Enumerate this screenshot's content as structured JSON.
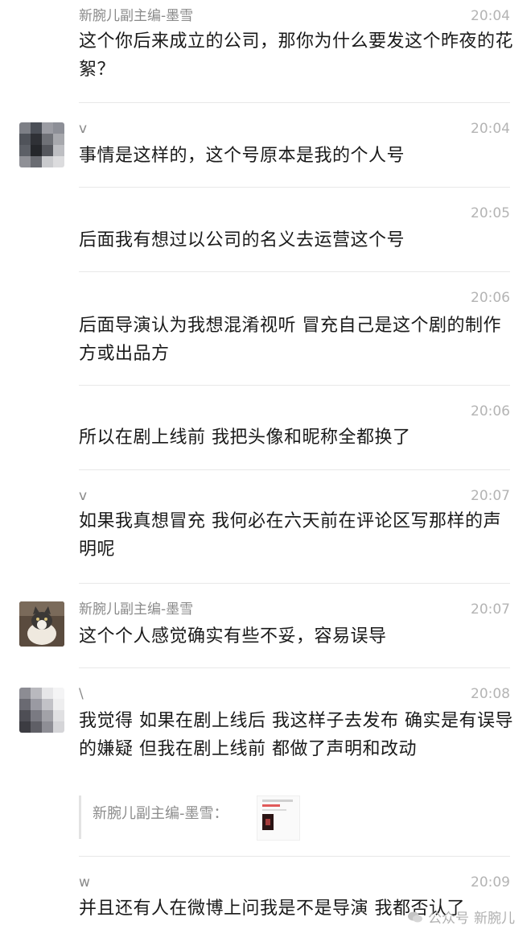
{
  "messages": [
    {
      "sender": "新腕儿副主编-墨雪",
      "time": "20:04",
      "text": "这个你后来成立的公司，那你为什么要发这个昨夜的花絮？"
    },
    {
      "sender": "v",
      "time": "20:04",
      "text": "事情是这样的，这个号原本是我的个人号"
    },
    {
      "sender": "",
      "time": "20:05",
      "text": "后面我有想过以公司的名义去运营这个号"
    },
    {
      "sender": "",
      "time": "20:06",
      "text": "后面导演认为我想混淆视听 冒充自己是这个剧的制作方或出品方"
    },
    {
      "sender": "",
      "time": "20:06",
      "text": "所以在剧上线前 我把头像和昵称全都换了"
    },
    {
      "sender": "v",
      "time": "20:07",
      "text": "如果我真想冒充 我何必在六天前在评论区写那样的声明呢"
    },
    {
      "sender": "新腕儿副主编-墨雪",
      "time": "20:07",
      "text": "这个个人感觉确实有些不妥，容易误导"
    },
    {
      "sender": "\\",
      "time": "20:08",
      "text": "我觉得 如果在剧上线后 我这样子去发布 确实是有误导的嫌疑 但我在剧上线前 都做了声明和改动",
      "quote": "新腕儿副主编-墨雪："
    },
    {
      "sender": "w",
      "time": "20:09",
      "text": "并且还有人在微博上问我是不是导演 我都否认了"
    }
  ],
  "watermark": {
    "left": "公众号",
    "right": "新腕儿"
  },
  "icons": {
    "watermark": "wechat-official-icon"
  }
}
